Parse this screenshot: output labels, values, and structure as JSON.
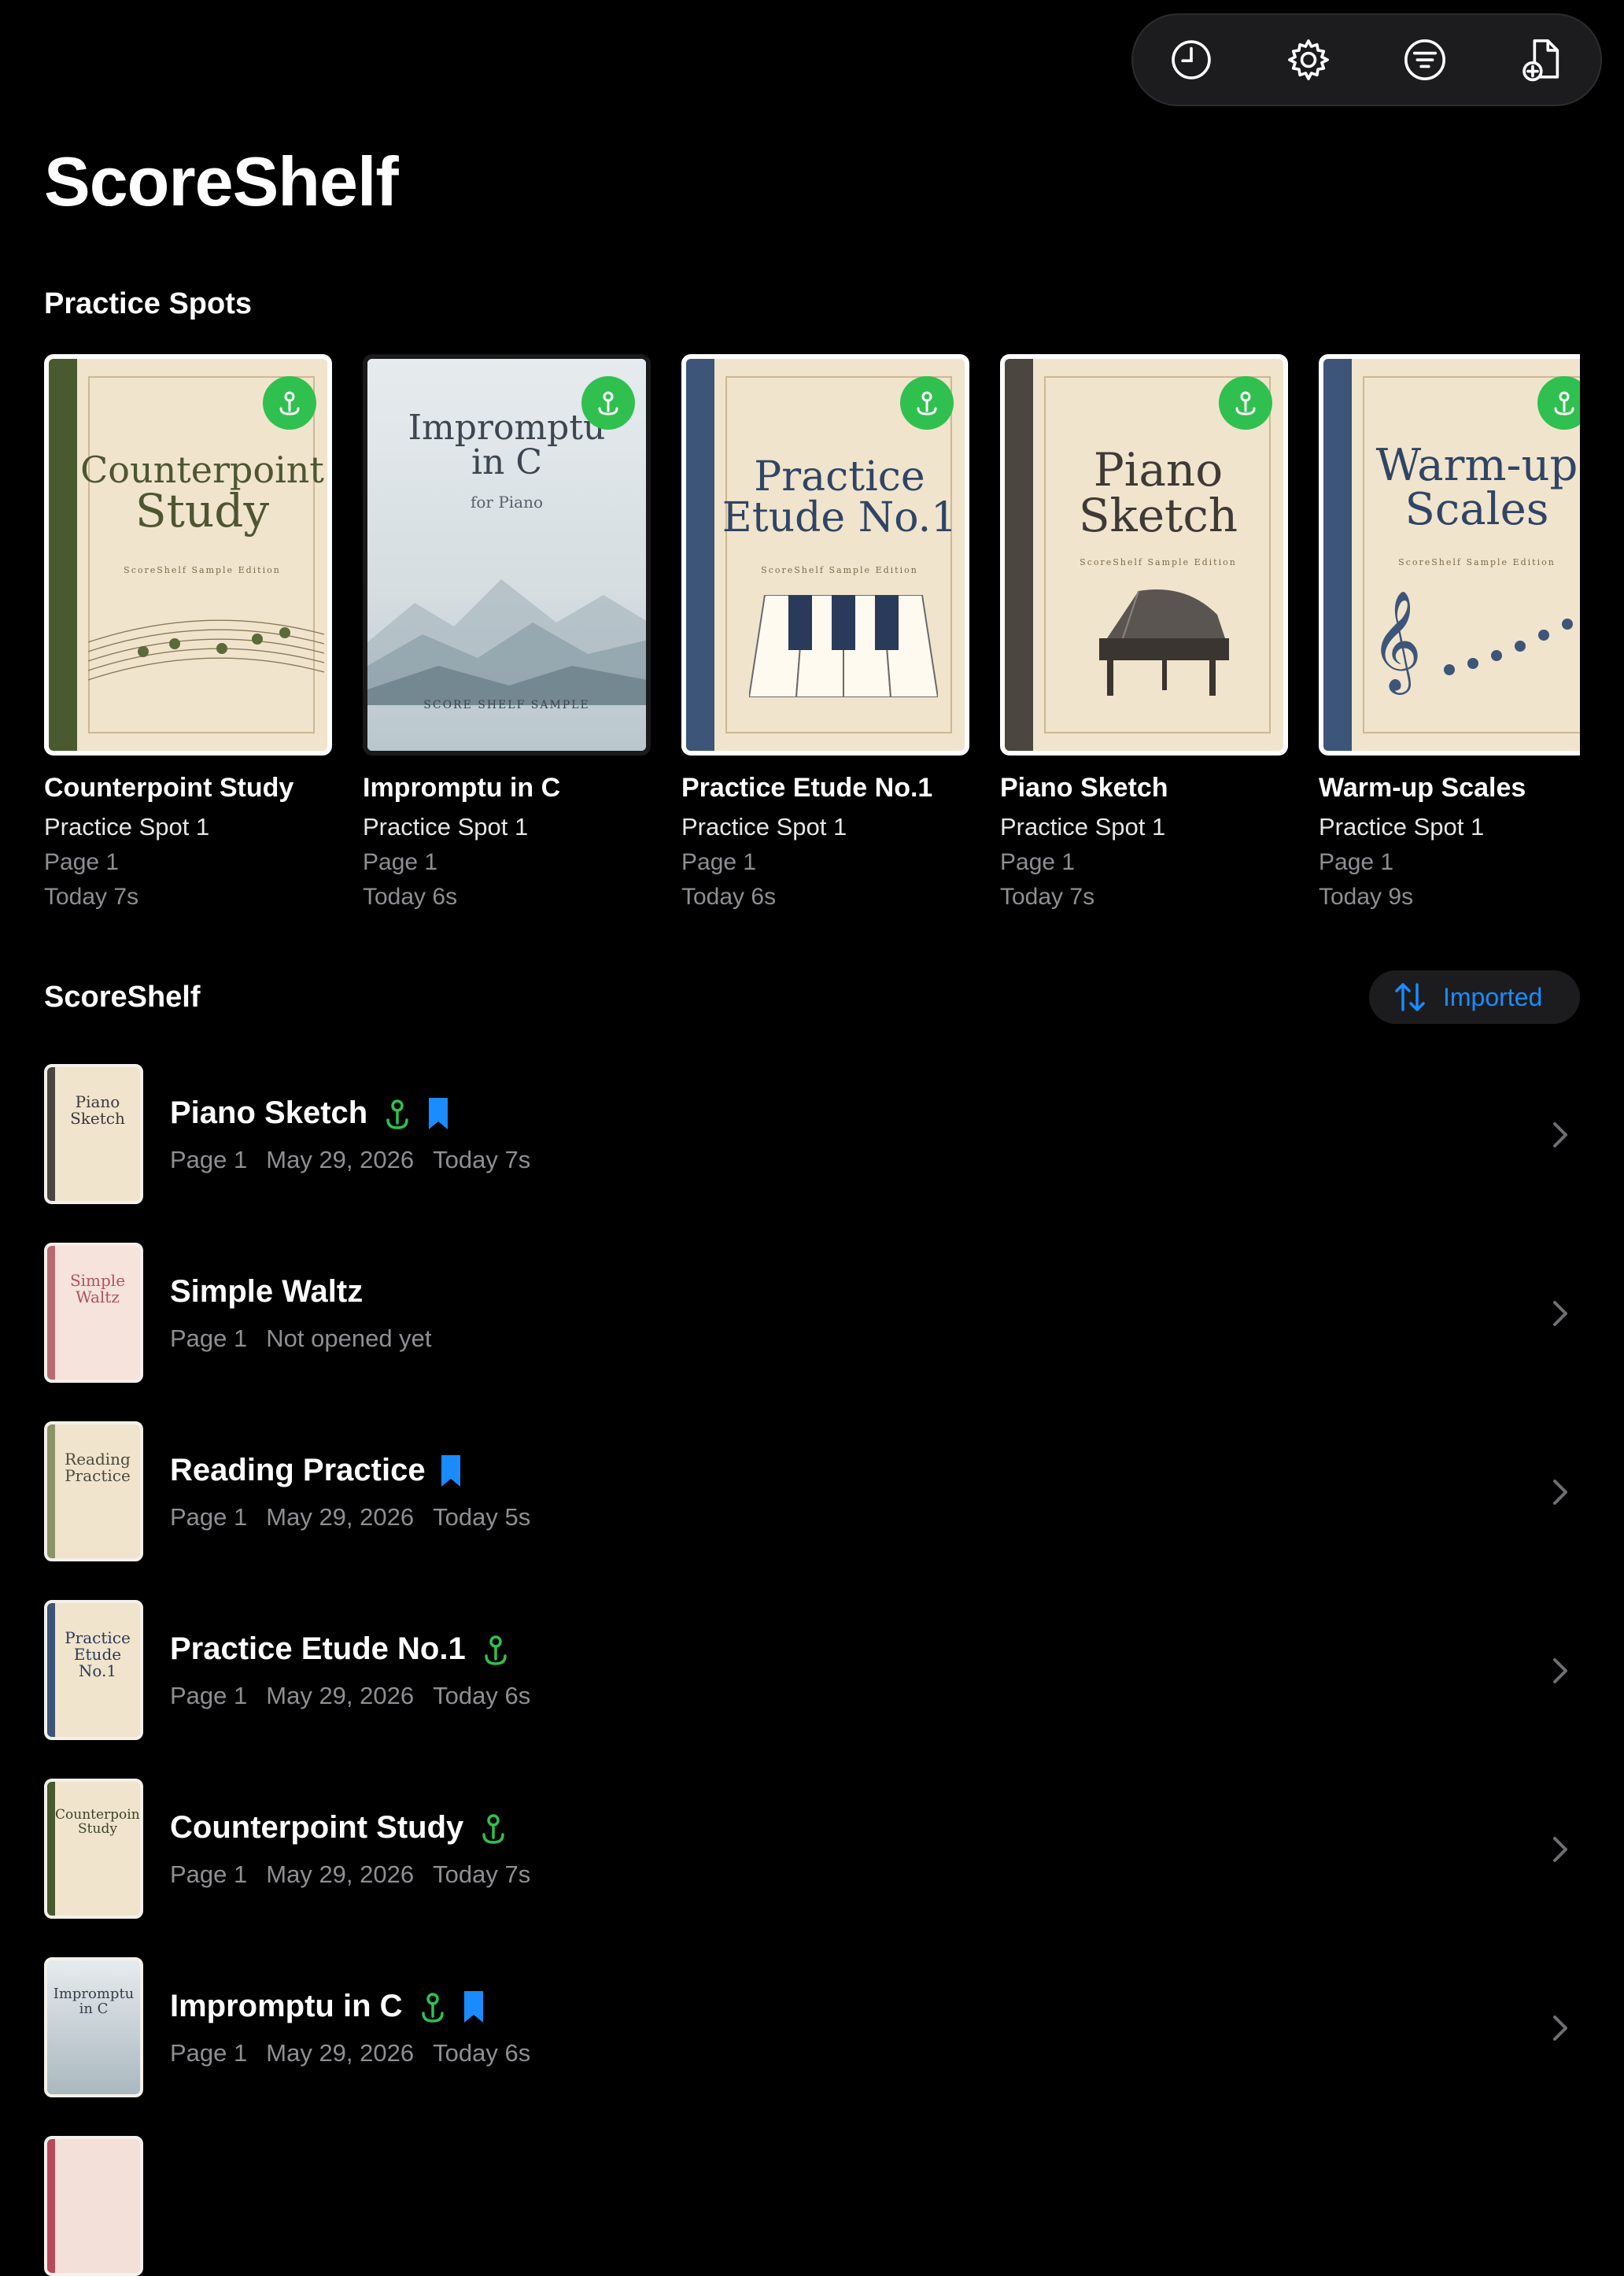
{
  "app": {
    "title": "ScoreShelf"
  },
  "toolbar": {
    "icons": [
      "clock-icon",
      "gear-icon",
      "filter-icon",
      "add-document-icon"
    ]
  },
  "practice_spots": {
    "title": "Practice Spots",
    "cards": [
      {
        "name": "Counterpoint Study",
        "spot": "Practice Spot 1",
        "page": "Page 1",
        "time": "Today 7s",
        "cover": {
          "line1": "Counterpoint",
          "line2": "Study",
          "sub": "ScoreShelf Sample Edition",
          "spine": "#4a5a2f"
        }
      },
      {
        "name": "Impromptu in C",
        "spot": "Practice Spot 1",
        "page": "Page 1",
        "time": "Today 6s",
        "cover": {
          "line1": "Impromptu",
          "line2": "in C",
          "sub": "for Piano",
          "footer": "SCORE SHELF SAMPLE"
        }
      },
      {
        "name": "Practice Etude No.1",
        "spot": "Practice Spot 1",
        "page": "Page 1",
        "time": "Today 6s",
        "cover": {
          "line1": "Practice",
          "line2": "Etude No.1",
          "sub": "ScoreShelf Sample Edition",
          "spine": "#3d5578"
        }
      },
      {
        "name": "Piano Sketch",
        "spot": "Practice Spot 1",
        "page": "Page 1",
        "time": "Today 7s",
        "cover": {
          "line1": "Piano",
          "line2": "Sketch",
          "sub": "ScoreShelf Sample Edition",
          "spine": "#4b4640"
        }
      },
      {
        "name": "Warm-up Scales",
        "spot": "Practice Spot 1",
        "page": "Page 1",
        "time": "Today 9s",
        "cover": {
          "line1": "Warm-up",
          "line2": "Scales",
          "sub": "ScoreShelf Sample Edition",
          "spine": "#3d5578"
        }
      }
    ]
  },
  "library": {
    "title": "ScoreShelf",
    "sort_label": "Imported",
    "rows": [
      {
        "name": "Piano Sketch",
        "page": "Page 1",
        "date": "May 29, 2026",
        "time": "Today 7s",
        "pin": true,
        "bookmark": true,
        "thumb": {
          "t1": "Piano",
          "t2": "Sketch",
          "spine": "#4b4640",
          "color": "#3a3a3a"
        }
      },
      {
        "name": "Simple Waltz",
        "page": "Page 1",
        "date": "Not opened yet",
        "time": "",
        "pin": false,
        "bookmark": false,
        "thumb": {
          "t1": "Simple",
          "t2": "Waltz",
          "spine": "#b86a72",
          "color": "#b0525c"
        }
      },
      {
        "name": "Reading Practice",
        "page": "Page 1",
        "date": "May 29, 2026",
        "time": "Today 5s",
        "pin": false,
        "bookmark": true,
        "thumb": {
          "t1": "Reading",
          "t2": "Practice",
          "spine": "#8a9466",
          "color": "#4a4a3a"
        }
      },
      {
        "name": "Practice Etude No.1",
        "page": "Page 1",
        "date": "May 29, 2026",
        "time": "Today 6s",
        "pin": true,
        "bookmark": false,
        "thumb": {
          "t1": "Practice",
          "t2": "Etude No.1",
          "spine": "#3d5578",
          "color": "#2a3a5a"
        }
      },
      {
        "name": "Counterpoint Study",
        "page": "Page 1",
        "date": "May 29, 2026",
        "time": "Today 7s",
        "pin": true,
        "bookmark": false,
        "thumb": {
          "t1": "Counterpoint",
          "t2": "Study",
          "spine": "#4a5a2f",
          "color": "#3a4228"
        }
      },
      {
        "name": "Impromptu in C",
        "page": "Page 1",
        "date": "May 29, 2026",
        "time": "Today 6s",
        "pin": true,
        "bookmark": true,
        "thumb": {
          "t1": "Impromptu",
          "t2": "in C",
          "spine": "#c8d2d6",
          "color": "#34404a"
        }
      }
    ]
  },
  "colors": {
    "pin": "#30c04f",
    "bookmark": "#1a8cff",
    "accent": "#1a8cff",
    "muted": "#8e8e93"
  }
}
